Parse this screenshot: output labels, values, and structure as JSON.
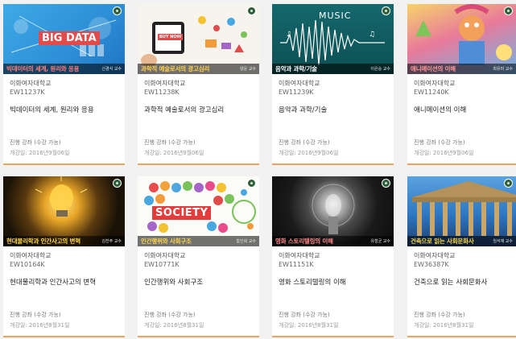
{
  "courses": [
    {
      "thumb_title": "빅데이터의 세계, 원리와 응용",
      "thumb_prof": "신경식 교수",
      "thumb_title_color": "#ff7f7f",
      "school": "이화여자대학교",
      "code": "EW11237K",
      "name": "빅데이터의 세계, 원리와 응용",
      "status": "진행 강좌 (수강 가능)",
      "date": "개강일: 2016년9월06일",
      "art_text": "BIG DATA"
    },
    {
      "thumb_title": "과학적 예술로서의 광고심리",
      "thumb_prof": "양윤 교수",
      "thumb_title_color": "#ffd24d",
      "school": "이화여자대학교",
      "code": "EW11238K",
      "name": "과학적 예술로서의 광고심리",
      "status": "진행 강좌 (수강 가능)",
      "date": "개강일: 2016년9월06일",
      "art_text": "BUY NOW"
    },
    {
      "thumb_title": "음악과 과학/기술",
      "thumb_prof": "이은승 교수",
      "thumb_title_color": "#ffffff",
      "school": "이화여자대학교",
      "code": "EW11239K",
      "name": "음악과 과학/기술",
      "status": "진행 강좌 (수강 가능)",
      "date": "개강일: 2016년9월06일",
      "art_text": "MUSIC"
    },
    {
      "thumb_title": "애니메이션의 이해",
      "thumb_prof": "최유미 교수",
      "thumb_title_color": "#ff9a9a",
      "school": "이화여자대학교",
      "code": "EW11240K",
      "name": "애니메이션의 이해",
      "status": "진행 강좌 (수강 가능)",
      "date": "개강일: 2016년9월06일",
      "art_text": ""
    },
    {
      "thumb_title": "현대물리학과 인간사고의 변혁",
      "thumb_prof": "김찬주 교수",
      "thumb_title_color": "#ffd84d",
      "school": "이화여자대학교",
      "code": "EW10164K",
      "name": "현대물리학과 인간사고의 변혁",
      "status": "진행 강좌 (수강 가능)",
      "date": "개강일: 2016년8월31일",
      "art_text": ""
    },
    {
      "thumb_title": "인간행위와 사회구조",
      "thumb_prof": "함인희 교수",
      "thumb_title_color": "#ffd84d",
      "school": "이화여자대학교",
      "code": "EW10771K",
      "name": "인간행위와 사회구조",
      "status": "진행 강좌 (수강 가능)",
      "date": "개강일: 2016년8월31일",
      "art_text": "SOCIETY"
    },
    {
      "thumb_title": "영화 스토리텔링의 이해",
      "thumb_prof": "유철균 교수",
      "thumb_title_color": "#ff8a8a",
      "school": "이화여자대학교",
      "code": "EW11151K",
      "name": "영화 스토리텔링의 이해",
      "status": "진행 강좌 (수강 가능)",
      "date": "개강일: 2016년8월31일",
      "art_text": ""
    },
    {
      "thumb_title": "건축으로 읽는 사회문화사",
      "thumb_prof": "임석재 교수",
      "thumb_title_color": "#ffd84d",
      "school": "이화여자대학교",
      "code": "EW36387K",
      "name": "건축으로 읽는 사회문화사",
      "status": "진행 강좌 (수강 가능)",
      "date": "개강일: 2016년8월31일",
      "art_text": ""
    }
  ]
}
